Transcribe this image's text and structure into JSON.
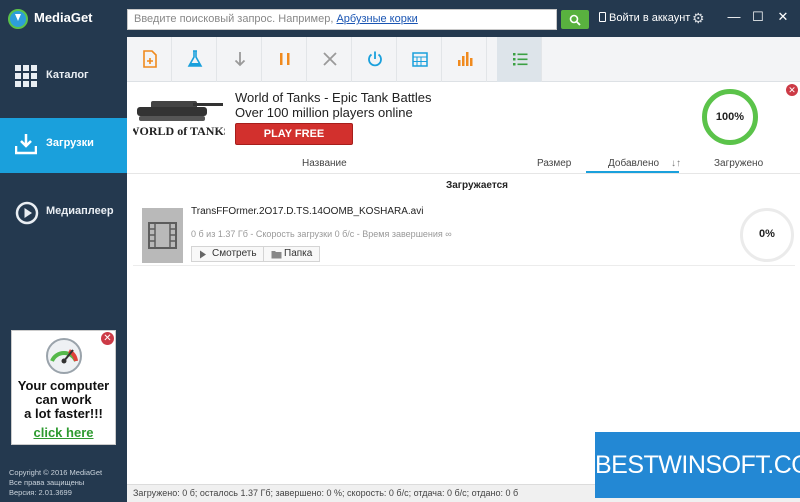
{
  "app": {
    "title": "MediaGet"
  },
  "search": {
    "placeholder": "Введите поисковый запрос. Например, ",
    "example_link": "Арбузные корки"
  },
  "header": {
    "login_label": "Войти в аккаунт"
  },
  "sidebar": {
    "items": [
      {
        "label": "Каталог",
        "icon": "grid-icon"
      },
      {
        "label": "Загрузки",
        "icon": "download-icon",
        "active": true
      },
      {
        "label": "Медиаплеер",
        "icon": "play-icon"
      }
    ],
    "ad": {
      "line1": "Your computer",
      "line2": "can work",
      "line3": "a lot faster!!!",
      "link": "click here"
    },
    "copyright": {
      "line1": "Copyright © 2016 MediaGet",
      "line2": "Все права защищены",
      "line3": "Версия: 2.01.3699"
    }
  },
  "toolbar": {
    "tools": [
      "add-file-icon",
      "flask-icon",
      "download-arrow-icon",
      "pause-icon",
      "cancel-icon",
      "power-icon",
      "calendar-icon",
      "chart-icon",
      "list-icon"
    ],
    "active": "list-icon"
  },
  "banner": {
    "logo_text": "WORLD of TANKS",
    "title": "World of Tanks - Epic Tank Battles",
    "subtitle": "Over 100 million players online",
    "button": "PLAY FREE",
    "progress_percent": "100%"
  },
  "columns": {
    "name": "Название",
    "size": "Размер",
    "added": "Добавлено",
    "sort_indicator": "↓↑",
    "downloaded": "Загружено"
  },
  "list": {
    "section_title": "Загружается",
    "items": [
      {
        "filename": "TransFFOrmer.2O17.D.TS.14OOMB_KOSHARA.avi",
        "status": "0 б из 1.37 Гб - Скорость загрузки 0 б/с - Время завершения ∞",
        "watch_label": "Смотреть",
        "folder_label": "Папка",
        "progress": "0%"
      }
    ]
  },
  "statusbar": {
    "text": "Загружено: 0 б; осталось 1.37 Гб; завершено: 0 %; скорость: 0 б/с; отдача: 0 б/с; отдано: 0 б"
  },
  "watermark": {
    "text": "BESTWINSOFT.COM"
  },
  "colors": {
    "sidebar_bg": "#24394f",
    "active_blue": "#1aa0dc",
    "accent_green": "#5bc34a",
    "toolbar_icon_orange": "#f08a1e"
  }
}
